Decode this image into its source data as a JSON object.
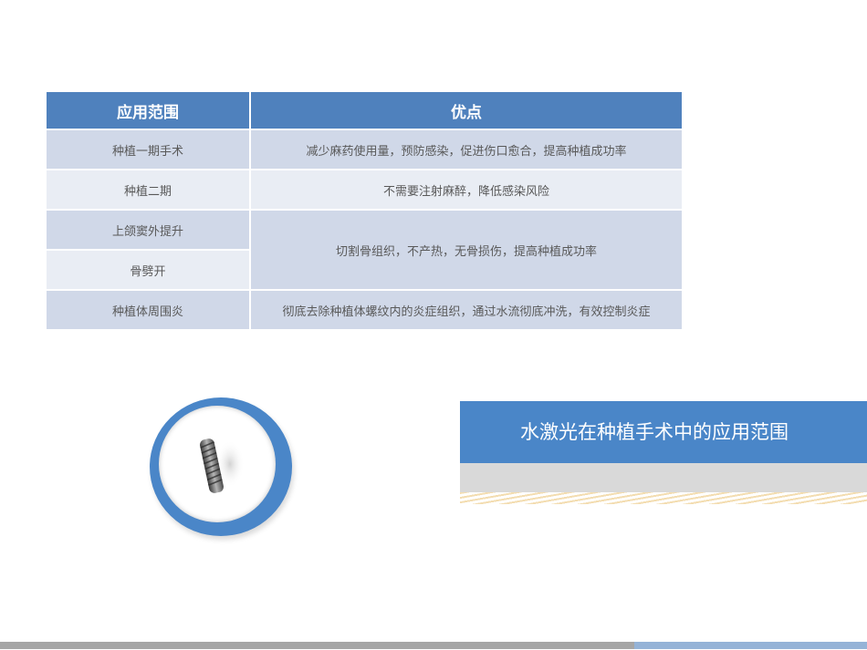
{
  "table": {
    "headers": [
      "应用范围",
      "优点"
    ],
    "rows": [
      {
        "scope": "种植一期手术",
        "benefit": "减少麻药使用量，预防感染，促进伤口愈合，提高种植成功率"
      },
      {
        "scope": "种植二期",
        "benefit": "不需要注射麻醉，降低感染风险"
      },
      {
        "scope": "上颌窦外提升",
        "benefit": "切割骨组织，不产热，无骨损伤，提高种植成功率"
      },
      {
        "scope": "骨劈开"
      },
      {
        "scope": "种植体周围炎",
        "benefit": "彻底去除种植体螺纹内的炎症组织，通过水流彻底冲洗，有效控制炎症"
      }
    ]
  },
  "title_band": {
    "text": "水激光在种植手术中的应用范围"
  },
  "colors": {
    "header_blue": "#4f81bd",
    "accent_blue": "#4a86c8",
    "row_dark": "#d0d8e8",
    "row_light": "#e9edf4",
    "gray": "#d9d9d9",
    "footer_gray": "#a6a6a6",
    "footer_blue": "#95b3d7"
  },
  "icons": {
    "implant": "dental-implant-icon"
  }
}
